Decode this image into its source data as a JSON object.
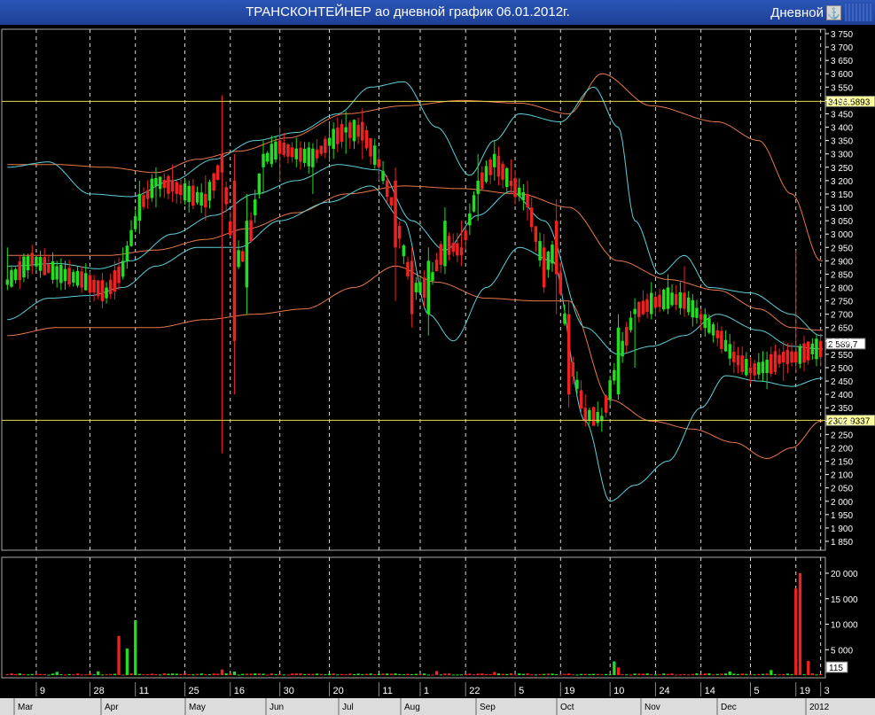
{
  "window": {
    "title": "ТРАНСКОНТЕЙНЕР ао дневной график 06.01.2012г.",
    "timeframe": "Дневной",
    "timeframe_icon": "anchor-icon"
  },
  "colors": {
    "up": "#22dd22",
    "down": "#ee2222",
    "bb_price": "#5ed0d8",
    "bb_slow": "#e8784a",
    "hline": "#e8d84a",
    "grid": "#d8d8d8",
    "volume_up": "#22dd22",
    "volume_down": "#ee2222",
    "bg": "#000000"
  },
  "chart_data": [
    {
      "type": "candlestick",
      "panel": "price",
      "y_ticks": [
        "3 750",
        "3 700",
        "3 650",
        "3 600",
        "3 550",
        "3 500",
        "3 450",
        "3 400",
        "3 350",
        "3 300",
        "3 250",
        "3 200",
        "3 150",
        "3 100",
        "3 050",
        "3 000",
        "2 950",
        "2 900",
        "2 850",
        "2 800",
        "2 750",
        "2 700",
        "2 650",
        "2 600",
        "2 550",
        "2 500",
        "2 450",
        "2 400",
        "2 350",
        "2 300",
        "2 250",
        "2 200",
        "2 150",
        "2 100",
        "2 050",
        "2 000",
        "1 950",
        "1 900",
        "1 850"
      ],
      "ylim": [
        1820,
        3770
      ],
      "grid": true,
      "horizontal_lines": [
        {
          "value": 3496.5893,
          "label": "3496.5893"
        },
        {
          "value": 2302.9337,
          "label": "2302.9337"
        }
      ],
      "last_price": {
        "value": 2589.7,
        "label": "2 589,7"
      },
      "anchors": [
        {
          "i": 0,
          "o": 2810,
          "c": 2830,
          "h": 2950,
          "l": 2790
        },
        {
          "i": 6,
          "o": 2930,
          "c": 2880,
          "h": 2960,
          "l": 2850
        },
        {
          "i": 12,
          "o": 2830,
          "c": 2880,
          "h": 2900,
          "l": 2800
        },
        {
          "i": 18,
          "o": 2860,
          "c": 2800,
          "h": 2880,
          "l": 2780
        },
        {
          "i": 24,
          "o": 2760,
          "c": 2800,
          "h": 2820,
          "l": 2740
        },
        {
          "i": 28,
          "o": 2840,
          "c": 2900,
          "h": 2950,
          "l": 2830
        },
        {
          "i": 32,
          "o": 3050,
          "c": 3150,
          "h": 3200,
          "l": 3000
        },
        {
          "i": 36,
          "o": 3180,
          "c": 3210,
          "h": 3250,
          "l": 3100
        },
        {
          "i": 40,
          "o": 3200,
          "c": 3160,
          "h": 3260,
          "l": 3120
        },
        {
          "i": 44,
          "o": 3120,
          "c": 3180,
          "h": 3200,
          "l": 3080
        },
        {
          "i": 48,
          "o": 3150,
          "c": 3100,
          "h": 3220,
          "l": 3050
        },
        {
          "i": 52,
          "o": 3300,
          "c": 3230,
          "h": 3520,
          "l": 2180
        },
        {
          "i": 55,
          "o": 3200,
          "c": 2600,
          "h": 3300,
          "l": 2400
        },
        {
          "i": 58,
          "o": 2800,
          "c": 3050,
          "h": 3150,
          "l": 2700
        },
        {
          "i": 62,
          "o": 3250,
          "c": 3300,
          "h": 3350,
          "l": 3150
        },
        {
          "i": 66,
          "o": 3350,
          "c": 3300,
          "h": 3400,
          "l": 3200
        },
        {
          "i": 70,
          "o": 3280,
          "c": 3320,
          "h": 3360,
          "l": 3250
        },
        {
          "i": 74,
          "o": 3250,
          "c": 3320,
          "h": 3340,
          "l": 3150
        },
        {
          "i": 78,
          "o": 3330,
          "c": 3360,
          "h": 3420,
          "l": 3270
        },
        {
          "i": 82,
          "o": 3380,
          "c": 3400,
          "h": 3460,
          "l": 3300
        },
        {
          "i": 86,
          "o": 3420,
          "c": 3350,
          "h": 3470,
          "l": 3280
        },
        {
          "i": 90,
          "o": 3280,
          "c": 3250,
          "h": 3320,
          "l": 3200
        },
        {
          "i": 94,
          "o": 3200,
          "c": 2950,
          "h": 3250,
          "l": 2750
        },
        {
          "i": 98,
          "o": 2900,
          "c": 2700,
          "h": 2950,
          "l": 2650
        },
        {
          "i": 102,
          "o": 2700,
          "c": 2900,
          "h": 2950,
          "l": 2620
        },
        {
          "i": 106,
          "o": 2880,
          "c": 3050,
          "h": 3100,
          "l": 2850
        },
        {
          "i": 110,
          "o": 2950,
          "c": 2920,
          "h": 3050,
          "l": 2880
        },
        {
          "i": 114,
          "o": 3150,
          "c": 3200,
          "h": 3300,
          "l": 3050
        },
        {
          "i": 118,
          "o": 3250,
          "c": 3300,
          "h": 3350,
          "l": 3200
        },
        {
          "i": 122,
          "o": 3200,
          "c": 3180,
          "h": 3280,
          "l": 3150
        },
        {
          "i": 126,
          "o": 3150,
          "c": 3100,
          "h": 3200,
          "l": 3050
        },
        {
          "i": 130,
          "o": 2950,
          "c": 2800,
          "h": 3000,
          "l": 2780
        },
        {
          "i": 133,
          "o": 3050,
          "c": 2850,
          "h": 3130,
          "l": 2700
        },
        {
          "i": 136,
          "o": 2700,
          "c": 2400,
          "h": 2750,
          "l": 2350
        },
        {
          "i": 140,
          "o": 2350,
          "c": 2300,
          "h": 2400,
          "l": 2280
        },
        {
          "i": 144,
          "o": 2300,
          "c": 2320,
          "h": 2350,
          "l": 2260
        },
        {
          "i": 148,
          "o": 2400,
          "c": 2650,
          "h": 2700,
          "l": 2380
        },
        {
          "i": 152,
          "o": 2700,
          "c": 2720,
          "h": 2760,
          "l": 2500
        },
        {
          "i": 156,
          "o": 2700,
          "c": 2780,
          "h": 2820,
          "l": 2680
        },
        {
          "i": 160,
          "o": 2720,
          "c": 2800,
          "h": 2850,
          "l": 2700
        },
        {
          "i": 164,
          "o": 2780,
          "c": 2720,
          "h": 2880,
          "l": 2690
        },
        {
          "i": 168,
          "o": 2700,
          "c": 2680,
          "h": 2720,
          "l": 2640
        },
        {
          "i": 172,
          "o": 2640,
          "c": 2610,
          "h": 2670,
          "l": 2580
        },
        {
          "i": 176,
          "o": 2560,
          "c": 2520,
          "h": 2600,
          "l": 2480
        },
        {
          "i": 180,
          "o": 2500,
          "c": 2480,
          "h": 2540,
          "l": 2440
        },
        {
          "i": 184,
          "o": 2480,
          "c": 2530,
          "h": 2560,
          "l": 2420
        },
        {
          "i": 188,
          "o": 2560,
          "c": 2520,
          "h": 2600,
          "l": 2450
        },
        {
          "i": 191,
          "o": 2560,
          "c": 2520,
          "h": 2940,
          "l": 2480
        },
        {
          "i": 195,
          "o": 2550,
          "c": 2590,
          "h": 2610,
          "l": 2530
        }
      ],
      "bollinger_fast": {
        "upper": [
          [
            0,
            3250
          ],
          [
            10,
            3270
          ],
          [
            20,
            3150
          ],
          [
            30,
            3140
          ],
          [
            40,
            3200
          ],
          [
            50,
            3280
          ],
          [
            60,
            3350
          ],
          [
            70,
            3380
          ],
          [
            80,
            3450
          ],
          [
            88,
            3550
          ],
          [
            96,
            3570
          ],
          [
            104,
            3400
          ],
          [
            112,
            3220
          ],
          [
            118,
            3350
          ],
          [
            124,
            3450
          ],
          [
            134,
            3420
          ],
          [
            142,
            3550
          ],
          [
            148,
            3400
          ],
          [
            152,
            3050
          ],
          [
            158,
            2850
          ],
          [
            164,
            2920
          ],
          [
            170,
            2800
          ],
          [
            180,
            2780
          ],
          [
            190,
            2700
          ],
          [
            197,
            2620
          ]
        ],
        "middle": [
          [
            0,
            2880
          ],
          [
            12,
            2890
          ],
          [
            22,
            2870
          ],
          [
            30,
            2900
          ],
          [
            40,
            3000
          ],
          [
            50,
            3070
          ],
          [
            60,
            3150
          ],
          [
            70,
            3200
          ],
          [
            80,
            3260
          ],
          [
            90,
            3240
          ],
          [
            98,
            3050
          ],
          [
            106,
            2940
          ],
          [
            114,
            3070
          ],
          [
            122,
            3160
          ],
          [
            130,
            3050
          ],
          [
            140,
            2650
          ],
          [
            148,
            2550
          ],
          [
            156,
            2580
          ],
          [
            164,
            2620
          ],
          [
            172,
            2700
          ],
          [
            182,
            2640
          ],
          [
            190,
            2580
          ],
          [
            197,
            2570
          ]
        ],
        "lower": [
          [
            0,
            2680
          ],
          [
            10,
            2760
          ],
          [
            20,
            2770
          ],
          [
            28,
            2800
          ],
          [
            36,
            2880
          ],
          [
            46,
            2950
          ],
          [
            56,
            2950
          ],
          [
            66,
            3050
          ],
          [
            78,
            3120
          ],
          [
            88,
            3180
          ],
          [
            96,
            3050
          ],
          [
            102,
            2700
          ],
          [
            108,
            2600
          ],
          [
            116,
            2800
          ],
          [
            124,
            2950
          ],
          [
            132,
            2900
          ],
          [
            140,
            2300
          ],
          [
            146,
            2000
          ],
          [
            152,
            2060
          ],
          [
            160,
            2150
          ],
          [
            168,
            2350
          ],
          [
            174,
            2470
          ],
          [
            182,
            2450
          ],
          [
            190,
            2430
          ],
          [
            197,
            2460
          ]
        ]
      },
      "bollinger_slow": {
        "upper": [
          [
            0,
            3260
          ],
          [
            12,
            3260
          ],
          [
            24,
            3250
          ],
          [
            36,
            3230
          ],
          [
            46,
            3280
          ],
          [
            56,
            3310
          ],
          [
            68,
            3360
          ],
          [
            82,
            3450
          ],
          [
            96,
            3480
          ],
          [
            110,
            3500
          ],
          [
            124,
            3490
          ],
          [
            136,
            3450
          ],
          [
            144,
            3600
          ],
          [
            156,
            3480
          ],
          [
            172,
            3420
          ],
          [
            182,
            3350
          ],
          [
            190,
            3150
          ],
          [
            197,
            2900
          ]
        ],
        "middle": [
          [
            0,
            2920
          ],
          [
            12,
            2920
          ],
          [
            24,
            2920
          ],
          [
            36,
            2940
          ],
          [
            48,
            2980
          ],
          [
            58,
            3020
          ],
          [
            70,
            3080
          ],
          [
            82,
            3150
          ],
          [
            96,
            3180
          ],
          [
            110,
            3170
          ],
          [
            124,
            3150
          ],
          [
            136,
            3100
          ],
          [
            148,
            2900
          ],
          [
            160,
            2830
          ],
          [
            172,
            2790
          ],
          [
            182,
            2720
          ],
          [
            190,
            2650
          ],
          [
            197,
            2640
          ]
        ],
        "lower": [
          [
            0,
            2620
          ],
          [
            12,
            2650
          ],
          [
            24,
            2650
          ],
          [
            36,
            2650
          ],
          [
            48,
            2680
          ],
          [
            60,
            2700
          ],
          [
            72,
            2720
          ],
          [
            84,
            2800
          ],
          [
            94,
            2880
          ],
          [
            104,
            2820
          ],
          [
            116,
            2760
          ],
          [
            128,
            2750
          ],
          [
            136,
            2750
          ],
          [
            146,
            2380
          ],
          [
            156,
            2300
          ],
          [
            166,
            2270
          ],
          [
            176,
            2220
          ],
          [
            184,
            2160
          ],
          [
            190,
            2200
          ],
          [
            197,
            2300
          ]
        ]
      },
      "n_bars": 198
    },
    {
      "type": "bar",
      "panel": "volume",
      "y_ticks": [
        "20 000",
        "15 000",
        "10 000",
        "5 000"
      ],
      "ylim": [
        0,
        21000
      ],
      "last_volume_label": "115",
      "spikes": [
        {
          "i": 12,
          "v": 650
        },
        {
          "i": 22,
          "v": 750
        },
        {
          "i": 27,
          "v": 7700
        },
        {
          "i": 29,
          "v": 5200
        },
        {
          "i": 31,
          "v": 10800
        },
        {
          "i": 52,
          "v": 1100
        },
        {
          "i": 55,
          "v": 700
        },
        {
          "i": 104,
          "v": 800
        },
        {
          "i": 118,
          "v": 600
        },
        {
          "i": 147,
          "v": 2700
        },
        {
          "i": 148,
          "v": 1500
        },
        {
          "i": 175,
          "v": 700
        },
        {
          "i": 185,
          "v": 1000
        },
        {
          "i": 191,
          "v": 17000
        },
        {
          "i": 192,
          "v": 20000
        },
        {
          "i": 194,
          "v": 2800
        }
      ],
      "base_volume": 250
    }
  ],
  "date_axis": {
    "day_labels": [
      "9",
      "28",
      "11",
      "25",
      "16",
      "30",
      "20",
      "11",
      "1",
      "22",
      "5",
      "19",
      "10",
      "24",
      "14",
      "5",
      "19",
      "3"
    ],
    "month_labels": [
      "Mar",
      "Apr",
      "May",
      "Jun",
      "Jul",
      "Aug",
      "Sep",
      "Oct",
      "Nov",
      "Dec",
      "2012"
    ]
  }
}
